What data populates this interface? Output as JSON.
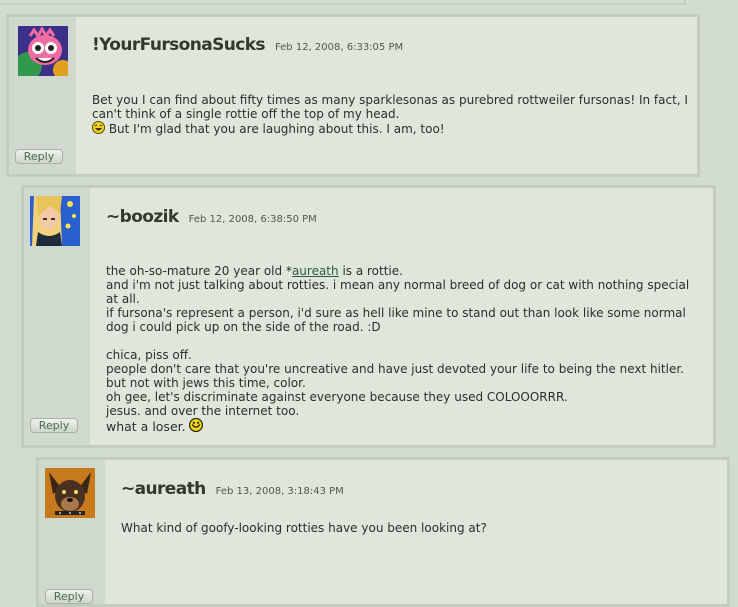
{
  "comments": [
    {
      "username": "!YourFursonaSucks",
      "timestamp": "Feb 12, 2008, 6:33:05 PM",
      "text_before": "Bet you I can find about fifty times as many sparklesonas as purebred rottweiler fursonas! In fact, I can't think of a single rottie off the top of my head.",
      "text_after": " But I'm glad that you are laughing about this. I am, too!",
      "reply_label": "Reply"
    },
    {
      "username": "~boozik",
      "timestamp": "Feb 12, 2008, 6:38:50 PM",
      "line1_before": "the oh-so-mature 20 year old *",
      "link": "aureath",
      "line1_after": " is a rottie.",
      "text_main": "and i'm not just talking about rotties. i mean any normal breed of dog or cat with nothing special at all.\nif fursona's represent a person, i'd sure as hell like mine to stand out than look like some normal dog i could pick up on the side of the road. :D\n\nchica, piss off.\npeople don't care that you're uncreative and have just devoted your life to being the next hitler.\nbut not with jews this time, color.\noh gee, let's discriminate against everyone because they used COLOOORRR.\njesus. and over the internet too.",
      "last_line": "what a loser.",
      "reply_label": "Reply"
    },
    {
      "username": "~aureath",
      "timestamp": "Feb 13, 2008, 3:18:43 PM",
      "text": "What kind of goofy-looking rotties have you been looking at?",
      "reply_label": "Reply"
    }
  ],
  "icons": [
    "avatar-monster-icon",
    "avatar-anime-girl-icon",
    "avatar-dog-icon",
    "smiley-laugh-icon",
    "smiley-grin-icon"
  ]
}
